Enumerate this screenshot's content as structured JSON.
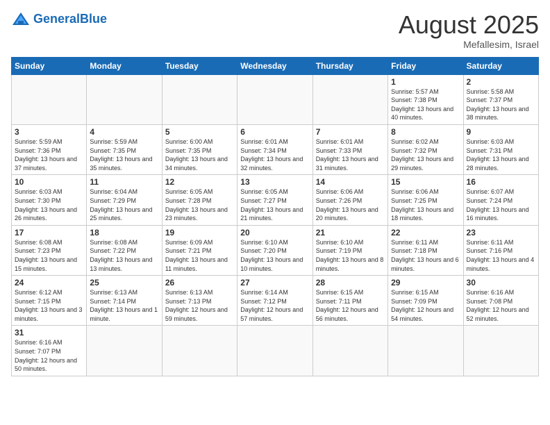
{
  "header": {
    "logo_general": "General",
    "logo_blue": "Blue",
    "title": "August 2025",
    "subtitle": "Mefallesim, Israel"
  },
  "weekdays": [
    "Sunday",
    "Monday",
    "Tuesday",
    "Wednesday",
    "Thursday",
    "Friday",
    "Saturday"
  ],
  "days": [
    {
      "num": "",
      "info": ""
    },
    {
      "num": "",
      "info": ""
    },
    {
      "num": "",
      "info": ""
    },
    {
      "num": "",
      "info": ""
    },
    {
      "num": "",
      "info": ""
    },
    {
      "num": "1",
      "info": "Sunrise: 5:57 AM\nSunset: 7:38 PM\nDaylight: 13 hours and 40 minutes."
    },
    {
      "num": "2",
      "info": "Sunrise: 5:58 AM\nSunset: 7:37 PM\nDaylight: 13 hours and 38 minutes."
    },
    {
      "num": "3",
      "info": "Sunrise: 5:59 AM\nSunset: 7:36 PM\nDaylight: 13 hours and 37 minutes."
    },
    {
      "num": "4",
      "info": "Sunrise: 5:59 AM\nSunset: 7:35 PM\nDaylight: 13 hours and 35 minutes."
    },
    {
      "num": "5",
      "info": "Sunrise: 6:00 AM\nSunset: 7:35 PM\nDaylight: 13 hours and 34 minutes."
    },
    {
      "num": "6",
      "info": "Sunrise: 6:01 AM\nSunset: 7:34 PM\nDaylight: 13 hours and 32 minutes."
    },
    {
      "num": "7",
      "info": "Sunrise: 6:01 AM\nSunset: 7:33 PM\nDaylight: 13 hours and 31 minutes."
    },
    {
      "num": "8",
      "info": "Sunrise: 6:02 AM\nSunset: 7:32 PM\nDaylight: 13 hours and 29 minutes."
    },
    {
      "num": "9",
      "info": "Sunrise: 6:03 AM\nSunset: 7:31 PM\nDaylight: 13 hours and 28 minutes."
    },
    {
      "num": "10",
      "info": "Sunrise: 6:03 AM\nSunset: 7:30 PM\nDaylight: 13 hours and 26 minutes."
    },
    {
      "num": "11",
      "info": "Sunrise: 6:04 AM\nSunset: 7:29 PM\nDaylight: 13 hours and 25 minutes."
    },
    {
      "num": "12",
      "info": "Sunrise: 6:05 AM\nSunset: 7:28 PM\nDaylight: 13 hours and 23 minutes."
    },
    {
      "num": "13",
      "info": "Sunrise: 6:05 AM\nSunset: 7:27 PM\nDaylight: 13 hours and 21 minutes."
    },
    {
      "num": "14",
      "info": "Sunrise: 6:06 AM\nSunset: 7:26 PM\nDaylight: 13 hours and 20 minutes."
    },
    {
      "num": "15",
      "info": "Sunrise: 6:06 AM\nSunset: 7:25 PM\nDaylight: 13 hours and 18 minutes."
    },
    {
      "num": "16",
      "info": "Sunrise: 6:07 AM\nSunset: 7:24 PM\nDaylight: 13 hours and 16 minutes."
    },
    {
      "num": "17",
      "info": "Sunrise: 6:08 AM\nSunset: 7:23 PM\nDaylight: 13 hours and 15 minutes."
    },
    {
      "num": "18",
      "info": "Sunrise: 6:08 AM\nSunset: 7:22 PM\nDaylight: 13 hours and 13 minutes."
    },
    {
      "num": "19",
      "info": "Sunrise: 6:09 AM\nSunset: 7:21 PM\nDaylight: 13 hours and 11 minutes."
    },
    {
      "num": "20",
      "info": "Sunrise: 6:10 AM\nSunset: 7:20 PM\nDaylight: 13 hours and 10 minutes."
    },
    {
      "num": "21",
      "info": "Sunrise: 6:10 AM\nSunset: 7:19 PM\nDaylight: 13 hours and 8 minutes."
    },
    {
      "num": "22",
      "info": "Sunrise: 6:11 AM\nSunset: 7:18 PM\nDaylight: 13 hours and 6 minutes."
    },
    {
      "num": "23",
      "info": "Sunrise: 6:11 AM\nSunset: 7:16 PM\nDaylight: 13 hours and 4 minutes."
    },
    {
      "num": "24",
      "info": "Sunrise: 6:12 AM\nSunset: 7:15 PM\nDaylight: 13 hours and 3 minutes."
    },
    {
      "num": "25",
      "info": "Sunrise: 6:13 AM\nSunset: 7:14 PM\nDaylight: 13 hours and 1 minute."
    },
    {
      "num": "26",
      "info": "Sunrise: 6:13 AM\nSunset: 7:13 PM\nDaylight: 12 hours and 59 minutes."
    },
    {
      "num": "27",
      "info": "Sunrise: 6:14 AM\nSunset: 7:12 PM\nDaylight: 12 hours and 57 minutes."
    },
    {
      "num": "28",
      "info": "Sunrise: 6:15 AM\nSunset: 7:11 PM\nDaylight: 12 hours and 56 minutes."
    },
    {
      "num": "29",
      "info": "Sunrise: 6:15 AM\nSunset: 7:09 PM\nDaylight: 12 hours and 54 minutes."
    },
    {
      "num": "30",
      "info": "Sunrise: 6:16 AM\nSunset: 7:08 PM\nDaylight: 12 hours and 52 minutes."
    },
    {
      "num": "31",
      "info": "Sunrise: 6:16 AM\nSunset: 7:07 PM\nDaylight: 12 hours and 50 minutes."
    },
    {
      "num": "",
      "info": ""
    },
    {
      "num": "",
      "info": ""
    },
    {
      "num": "",
      "info": ""
    },
    {
      "num": "",
      "info": ""
    },
    {
      "num": "",
      "info": ""
    },
    {
      "num": "",
      "info": ""
    }
  ]
}
